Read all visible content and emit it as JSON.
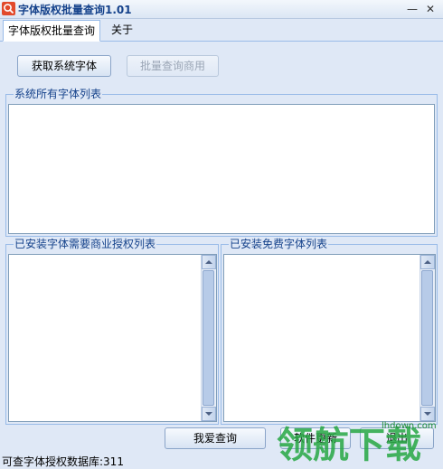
{
  "window": {
    "title": "字体版权批量查询1.01",
    "minimize_glyph": "—",
    "close_glyph": "✕"
  },
  "tabs": [
    {
      "label": "字体版权批量查询",
      "active": true
    },
    {
      "label": "关于",
      "active": false
    }
  ],
  "toolbar": {
    "get_fonts_label": "获取系统字体",
    "batch_query_label": "批量查询商用"
  },
  "groups": {
    "all_fonts_title": "系统所有字体列表",
    "commercial_title": "已安装字体需要商业授权列表",
    "free_title": "已安装免费字体列表"
  },
  "bottom_buttons": {
    "love_query_label": "我爱查询",
    "software_update_label": "软件更新",
    "exit_label": "退出"
  },
  "status": {
    "text": "可查字体授权数据库:311"
  },
  "watermark": {
    "main_text": "领航下载",
    "site_text": "lhdown.com"
  },
  "colors": {
    "background": "#dfe8f6",
    "border": "#99bbe8",
    "title_text": "#15428b",
    "watermark": "#27a844"
  }
}
